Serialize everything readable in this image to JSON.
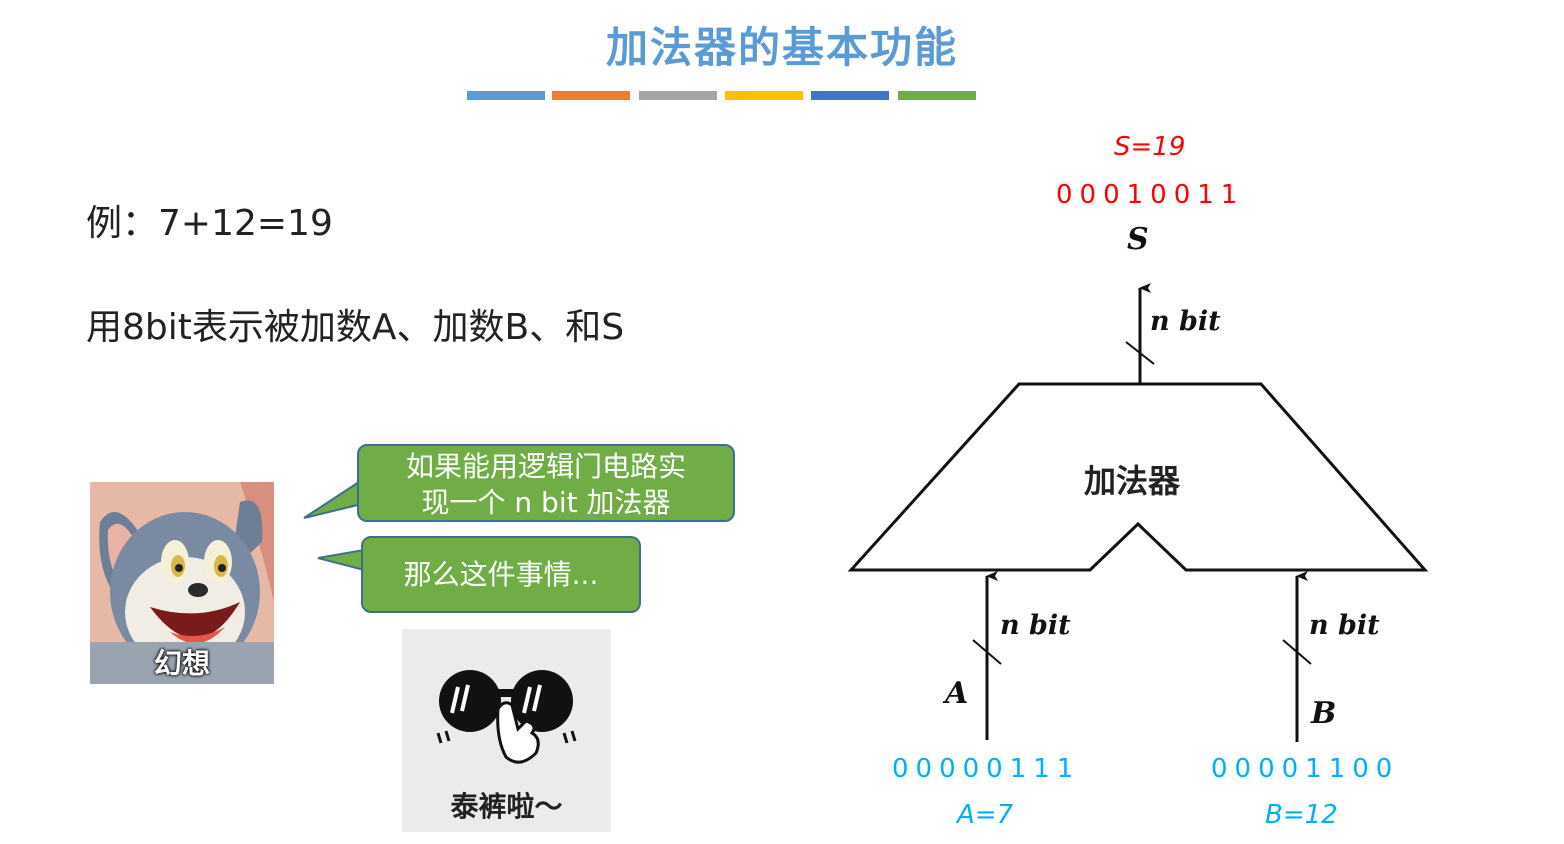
{
  "title": "加法器的基本功能",
  "accent_bars": [
    "#5b9bd5",
    "#ed7d31",
    "#a5a5a5",
    "#ffc000",
    "#4472c4",
    "#70ad47"
  ],
  "example_line": "例：7+12=19",
  "description_line": "用8bit表示被加数A、加数B、和S",
  "bubbles": {
    "first": [
      "如果能用逻辑门电路实",
      "现一个 n bit 加法器"
    ],
    "second": "那么这件事情..."
  },
  "memes": {
    "cat_label": "幻想",
    "sunglasses_label": "泰裤啦～"
  },
  "diagram": {
    "block_label": "加法器",
    "output": {
      "symbol": "S",
      "width_label": "n bit",
      "bits": "00010011",
      "value_label": "S=19",
      "color": "#ff0000"
    },
    "input_a": {
      "symbol": "A",
      "width_label": "n bit",
      "bits": "00000111",
      "value_label": "A=7",
      "color": "#00b0f0"
    },
    "input_b": {
      "symbol": "B",
      "width_label": "n bit",
      "bits": "00001100",
      "value_label": "B=12",
      "color": "#00b0f0"
    }
  }
}
